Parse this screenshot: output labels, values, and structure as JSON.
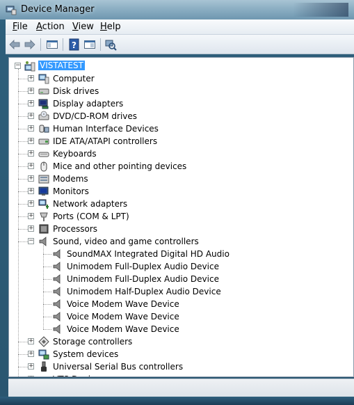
{
  "window": {
    "title": "Device Manager"
  },
  "menu": [
    {
      "label": "File",
      "u": "F",
      "rest": "ile"
    },
    {
      "label": "Action",
      "u": "A",
      "rest": "ction"
    },
    {
      "label": "View",
      "u": "V",
      "rest": "iew"
    },
    {
      "label": "Help",
      "u": "H",
      "rest": "elp"
    }
  ],
  "toolbar": {
    "icons": [
      "back-arrow-icon",
      "forward-arrow-icon",
      "show-hide-console-tree-icon",
      "help-icon",
      "properties-icon",
      "scan-hardware-changes-icon"
    ]
  },
  "tree": {
    "root": "VISTATEST",
    "categories": [
      {
        "label": "Computer",
        "icon": "computer-icon"
      },
      {
        "label": "Disk drives",
        "icon": "disk-drive-icon"
      },
      {
        "label": "Display adapters",
        "icon": "display-adapter-icon"
      },
      {
        "label": "DVD/CD-ROM drives",
        "icon": "dvd-drive-icon"
      },
      {
        "label": "Human Interface Devices",
        "icon": "hid-icon"
      },
      {
        "label": "IDE ATA/ATAPI controllers",
        "icon": "ide-controller-icon"
      },
      {
        "label": "Keyboards",
        "icon": "keyboard-icon"
      },
      {
        "label": "Mice and other pointing devices",
        "icon": "mouse-icon"
      },
      {
        "label": "Modems",
        "icon": "modem-icon"
      },
      {
        "label": "Monitors",
        "icon": "monitor-icon"
      },
      {
        "label": "Network adapters",
        "icon": "network-adapter-icon"
      },
      {
        "label": "Ports (COM & LPT)",
        "icon": "port-icon"
      },
      {
        "label": "Processors",
        "icon": "processor-icon"
      },
      {
        "label": "Sound, video and game controllers",
        "icon": "speaker-icon",
        "expanded": true,
        "children": [
          "SoundMAX Integrated Digital HD Audio",
          "Unimodem Full-Duplex Audio Device",
          "Unimodem Full-Duplex Audio Device",
          "Unimodem Half-Duplex Audio Device",
          "Voice Modem Wave Device",
          "Voice Modem Wave Device",
          "Voice Modem Wave Device"
        ]
      },
      {
        "label": "Storage controllers",
        "icon": "storage-controller-icon"
      },
      {
        "label": "System devices",
        "icon": "system-devices-icon"
      },
      {
        "label": "Universal Serial Bus controllers",
        "icon": "usb-icon"
      },
      {
        "label": "VTS Devic",
        "icon": "vts-device-icon"
      }
    ]
  }
}
